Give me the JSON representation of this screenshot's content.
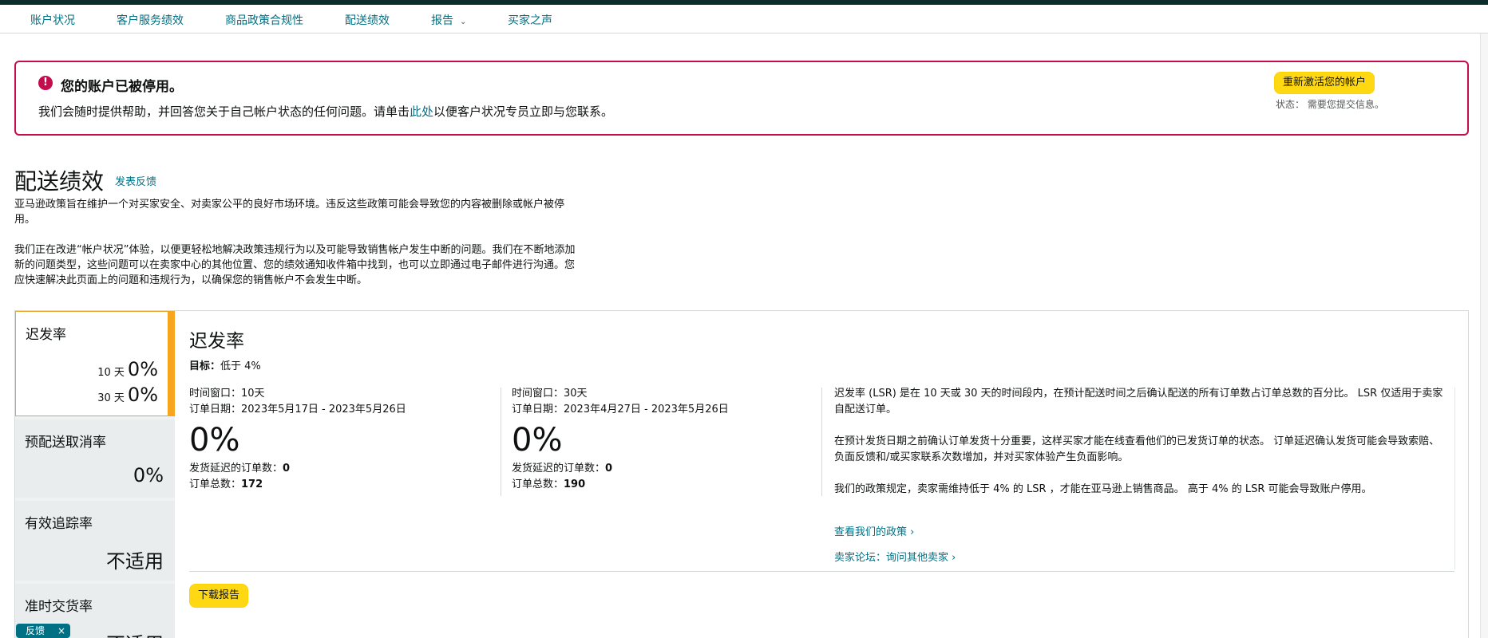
{
  "nav": {
    "items": [
      "账户状况",
      "客户服务绩效",
      "商品政策合规性",
      "配送绩效",
      "报告",
      "买家之声"
    ],
    "dropdown_icon": "chevron-down-icon"
  },
  "alert": {
    "icon": "exclamation-icon",
    "title": "您的账户已被停用。",
    "text_before": "我们会随时提供帮助，并回答您关于自己帐户状态的任何问题。请单击",
    "link": "此处",
    "text_after": "以便客户状况专员立即与您联系。",
    "button": "重新激活您的帐户",
    "status": "状态： 需要您提交信息。"
  },
  "page": {
    "title": "配送绩效",
    "feedback": "发表反馈",
    "intro_1": "亚马逊政策旨在维护一个对买家安全、对卖家公平的良好市场环境。违反这些政策可能会导致您的内容被删除或帐户被停用。",
    "intro_2": "我们正在改进“帐户状况”体验，以便更轻松地解决政策违规行为以及可能导致销售帐户发生中断的问题。我们在不断地添加新的问题类型，这些问题可以在卖家中心的其他位置、您的绩效通知收件箱中找到，也可以立即通过电子邮件进行沟通。您应快速解决此页面上的问题和违规行为，以确保您的销售帐户不会发生中断。"
  },
  "sidebar": {
    "lsr": {
      "label": "迟发率",
      "row1_days": "10 天",
      "row1_val": "0%",
      "row2_days": "30 天",
      "row2_val": "0%"
    },
    "cancel": {
      "label": "预配送取消率",
      "value": "0%"
    },
    "tracking": {
      "label": "有效追踪率",
      "value": "不适用"
    },
    "ontime": {
      "label": "准时交货率",
      "value": "不适用"
    }
  },
  "detail": {
    "title": "迟发率",
    "goal_label": "目标：",
    "goal_value": "低于 4%",
    "col1": {
      "window": "时间窗口：10天",
      "dates": "订单日期：2023年5月17日 - 2023年5月26日",
      "pct": "0%",
      "late_label": "发货延迟的订单数：",
      "late_value": "0",
      "total_label": "订单总数：",
      "total_value": "172"
    },
    "col2": {
      "window": "时间窗口：30天",
      "dates": "订单日期：2023年4月27日 - 2023年5月26日",
      "pct": "0%",
      "late_label": "发货延迟的订单数：",
      "late_value": "0",
      "total_label": "订单总数：",
      "total_value": "190"
    },
    "desc_1": "迟发率 (LSR) 是在 10 天或 30 天的时间段内，在预计配送时间之后确认配送的所有订单数占订单总数的百分比。 LSR 仅适用于卖家自配送订单。",
    "desc_2": "在预计发货日期之前确认订单发货十分重要，这样买家才能在线查看他们的已发货订单的状态。 订单延迟确认发货可能会导致索赔、负面反馈和/或买家联系次数增加，并对买家体验产生负面影响。",
    "desc_3": "我们的政策规定，卖家需维持低于 4% 的 LSR ，才能在亚马逊上销售商品。 高于 4% 的 LSR 可能会导致账户停用。",
    "policy_link": "查看我们的政策",
    "forum_link": "卖家论坛：询问其他卖家",
    "link_icon": "chevron-right-icon",
    "download": "下载报告"
  },
  "feedback_chip": {
    "label": "反馈",
    "close": "×"
  }
}
